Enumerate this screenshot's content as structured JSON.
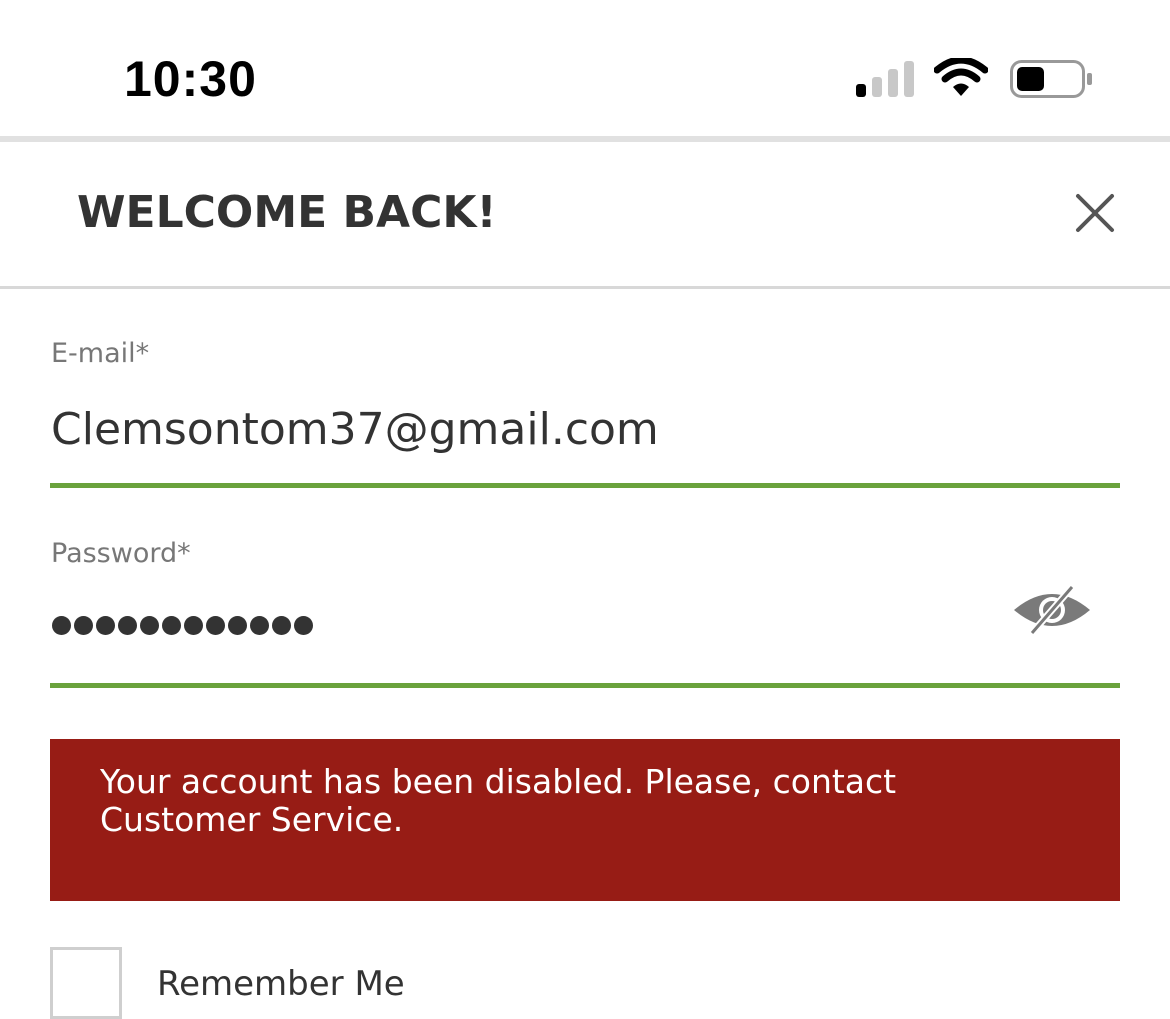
{
  "status_bar": {
    "time": "10:30",
    "signal_icon": "cellular-signal-icon",
    "wifi_icon": "wifi-icon",
    "battery_icon": "battery-icon",
    "battery_level": 0.45
  },
  "header": {
    "title": "WELCOME BACK!",
    "close_icon": "close-icon"
  },
  "form": {
    "email": {
      "label": "E-mail*",
      "value": "Clemsontom37@gmail.com"
    },
    "password": {
      "label": "Password*",
      "masked_length": 12,
      "toggle_icon": "eye-slash-icon"
    },
    "error_message": "Your account has been disabled. Please, contact Customer Service.",
    "remember_me": {
      "label": "Remember Me",
      "checked": false
    }
  },
  "colors": {
    "accent_underline": "#6aa23c",
    "error_background": "#971c15",
    "error_text": "#ffffff",
    "title_text": "#333333",
    "label_text": "#777777"
  }
}
